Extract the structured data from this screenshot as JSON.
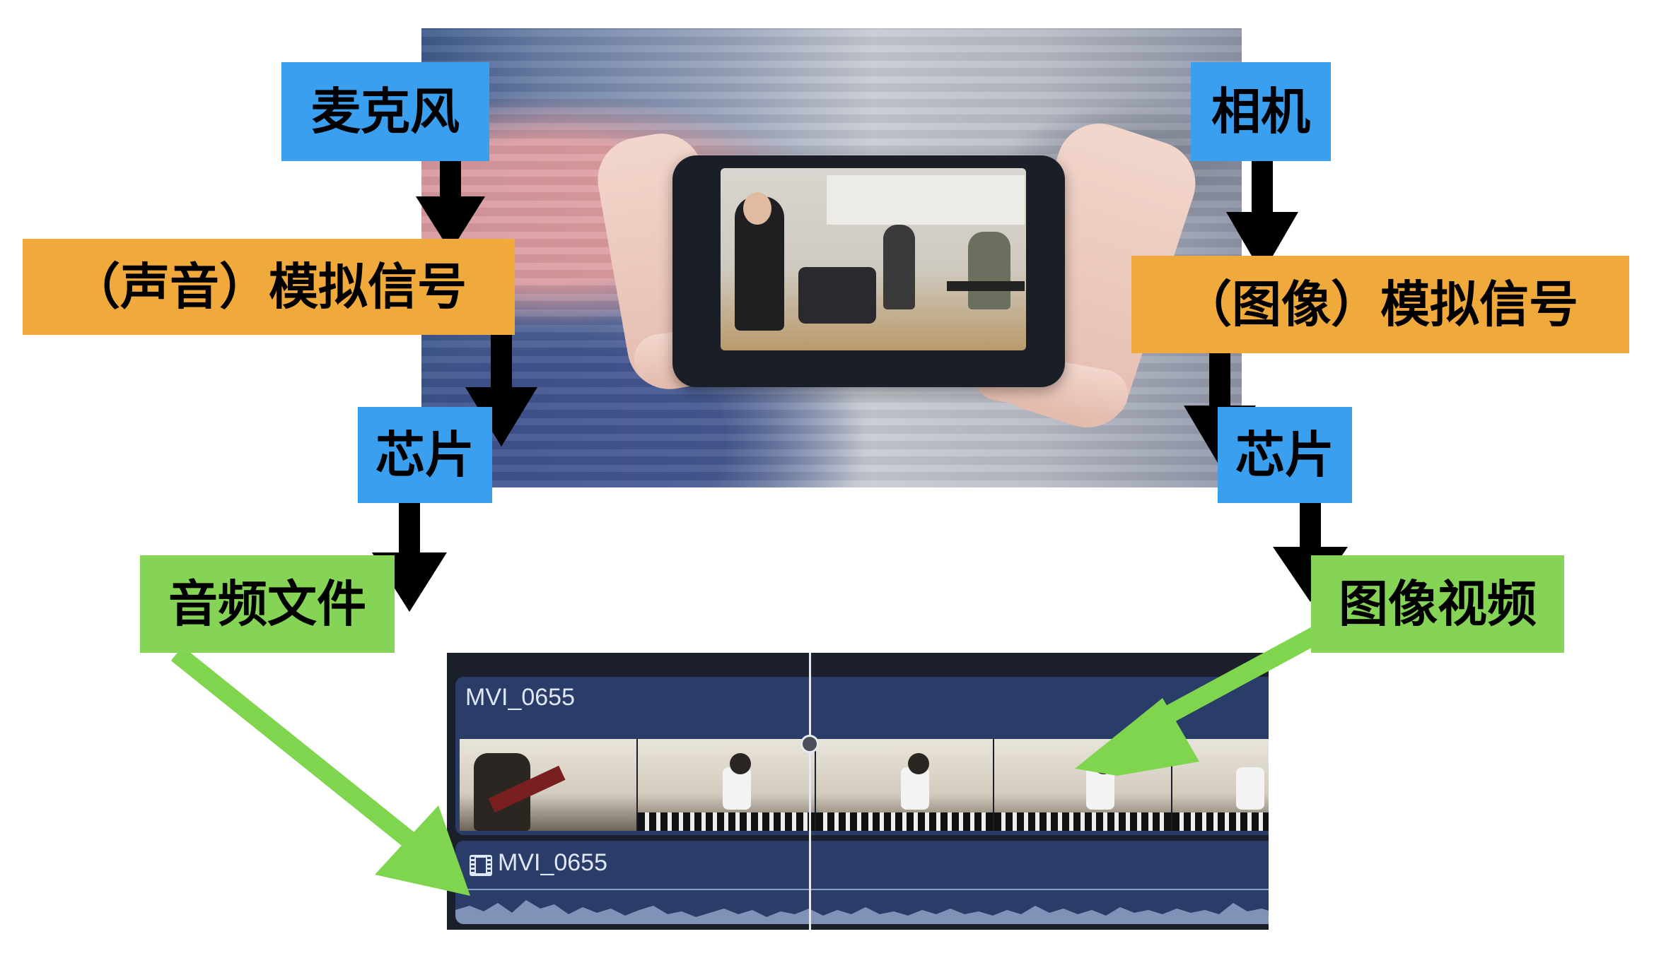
{
  "labels": {
    "microphone": "麦克风",
    "camera": "相机",
    "sound_analog": "（声音）模拟信号",
    "image_analog": "（图像）模拟信号",
    "chip_left": "芯片",
    "chip_right": "芯片",
    "audio_file": "音频文件",
    "image_video": "图像视频"
  },
  "timeline": {
    "video_clip_title": "MVI_0655",
    "audio_clip_title": "MVI_0655"
  },
  "colors": {
    "blue_label": "#3b9ff0",
    "orange_label": "#f0aa3c",
    "green_label": "#86d455",
    "green_arrow": "#7fd54e",
    "black_arrow": "#000000",
    "timeline_bg": "#1b1f2b",
    "clip_bg": "#2a3d68",
    "waveform": "#7f93b8"
  },
  "icons": {
    "audio_clip_icon": "film-strip-icon"
  }
}
